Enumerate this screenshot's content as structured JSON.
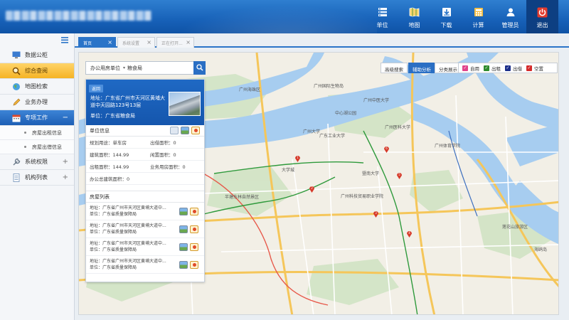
{
  "header": {
    "nav": [
      {
        "label": "单位",
        "icon": "unit-icon"
      },
      {
        "label": "地图",
        "icon": "map-icon"
      },
      {
        "label": "下载",
        "icon": "download-icon"
      },
      {
        "label": "计算",
        "icon": "calculator-icon"
      },
      {
        "label": "管理员",
        "icon": "admin-icon"
      },
      {
        "label": "退出",
        "icon": "power-icon"
      }
    ]
  },
  "sidebar": {
    "items": [
      {
        "label": "数据公柜"
      },
      {
        "label": "综合查阅"
      },
      {
        "label": "地图检索"
      },
      {
        "label": "业务办理"
      },
      {
        "label": "专项工作",
        "toggle": "−"
      },
      {
        "label": "房屋出租信息"
      },
      {
        "label": "房屋出借信息"
      },
      {
        "label": "系统权限",
        "toggle": "+"
      },
      {
        "label": "机构列表",
        "toggle": "+"
      }
    ]
  },
  "tabs": [
    {
      "label": "首页",
      "close": "×"
    },
    {
      "label": "系统设置",
      "close": "×"
    },
    {
      "label": "正在打开...",
      "close": "×"
    }
  ],
  "search": {
    "type_label": "办公用房单位",
    "caret": "▾",
    "value": "粮食局"
  },
  "panel": {
    "back": "返回",
    "address": "地址：广东省广州市天河区黄埔大道中天园路123号13层",
    "unit": "单位：广东省粮食局",
    "info_title": "单位信息",
    "info": [
      {
        "left": "规划用途：单车房",
        "right": "出借面积：0"
      },
      {
        "left": "建筑面积：144.99",
        "right": "闲置面积：0"
      },
      {
        "left": "出租面积：144.99",
        "right": "业务用房面积：0"
      },
      {
        "left": "办公总建筑面积：0",
        "right": ""
      }
    ],
    "list_title": "房屋列表",
    "houses": [
      {
        "addr": "地址：广东省广州市天河区黄埔大道中...",
        "unit": "单位：广东省质量保障局"
      },
      {
        "addr": "地址：广东省广州市天河区黄埔大道中...",
        "unit": "单位：广东省质量保障局"
      },
      {
        "addr": "地址：广东省广州市天河区黄埔大道中...",
        "unit": "单位：广东省质量保障局"
      },
      {
        "addr": "地址：广东省广州市天河区黄埔大道中...",
        "unit": "单位：广东省质量保障局"
      }
    ]
  },
  "map_tools": {
    "advanced": "高级搜索",
    "assist": "辅助分析",
    "classify": "分类展示"
  },
  "legend": [
    {
      "label": "自用",
      "color": "#e0438b",
      "check": "✓"
    },
    {
      "label": "出租",
      "color": "#2e8b2e",
      "check": "✓"
    },
    {
      "label": "出借",
      "color": "#1c2f8a",
      "check": "✓"
    },
    {
      "label": "空置",
      "color": "#d42a2a",
      "check": "✓"
    }
  ],
  "map_labels": [
    "广州海珠区",
    "广州国际生物岛",
    "中心湖公园",
    "广州中医大学",
    "广东工业大学",
    "广州大学",
    "广州医科大学",
    "广州体育学院",
    "暨南大学",
    "广州科技贸易职业学院",
    "大学城",
    "半塘东林自然景区",
    "莲花山旅游区",
    "海鸥岛"
  ],
  "pins": [
    "1",
    "2",
    "3",
    "4",
    "5",
    "6"
  ],
  "colors": {
    "accent": "#2a74c8",
    "header": "#1761b8",
    "active_menu": "#f5b325"
  }
}
